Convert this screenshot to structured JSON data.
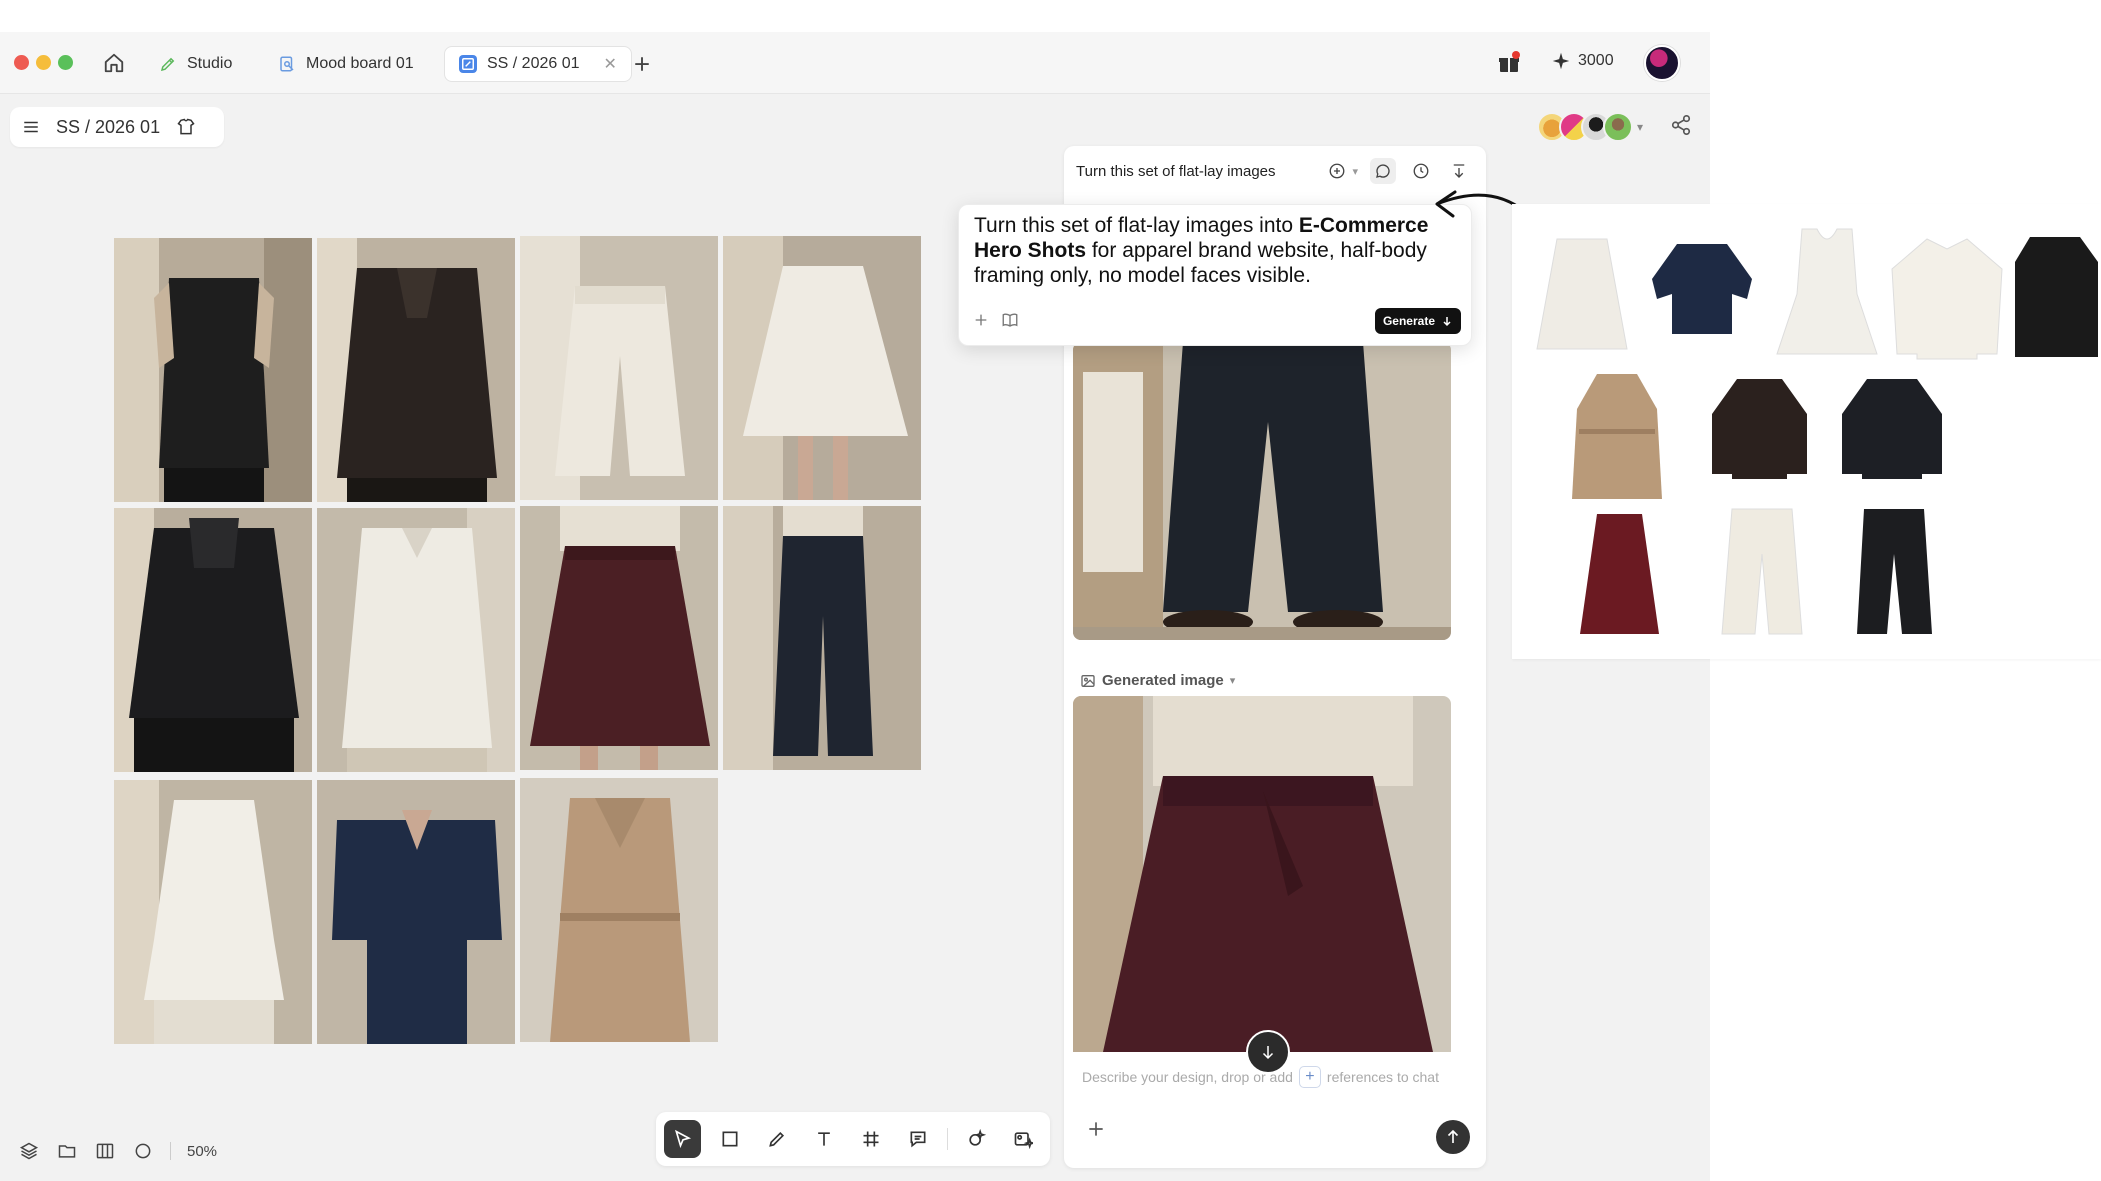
{
  "window": {
    "tabs": [
      {
        "label": "Studio"
      },
      {
        "label": "Mood board 01"
      },
      {
        "label": "SS / 2026 01"
      }
    ],
    "credits": "3000"
  },
  "project": {
    "title": "SS / 2026 01"
  },
  "chat": {
    "header_title": "Turn this set of flat-lay images",
    "prompt_part1": "Turn this set of flat-lay images into ",
    "prompt_bold": "E-Commerce Hero Shots",
    "prompt_part2": " for apparel brand website, half-body framing only, no model faces visible.",
    "generate_label": "Generate",
    "generated_label": "Generated image",
    "input_placeholder_before": "Describe your design, drop or add",
    "input_placeholder_after": "references to chat"
  },
  "canvas": {
    "zoom": "50%"
  },
  "colors": {
    "accent_green": "#5cb85c",
    "accent_blue": "#3b82f6",
    "tab_active_bg": "#ffffff",
    "dark": "#111111"
  },
  "icons": {
    "home": "home-icon",
    "gift": "gift-icon",
    "sparkle": "sparkle-icon",
    "share": "share-icon",
    "menu": "menu-icon",
    "send": "send-icon"
  }
}
